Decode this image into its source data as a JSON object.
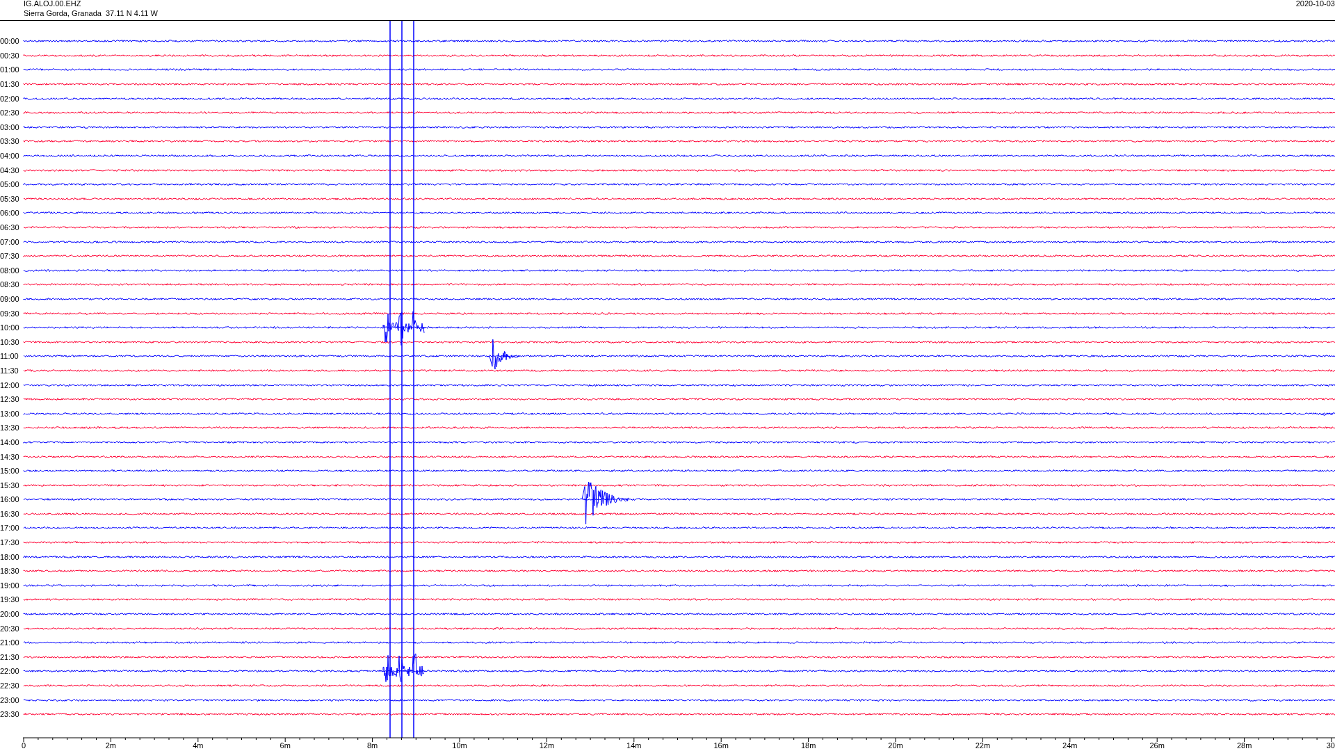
{
  "header": {
    "station": "IG.ALOJ.00.EHZ",
    "location": "Sierra Gorda, Granada  37.11 N 4.11 W",
    "date": "2020-10-03"
  },
  "rows": [
    {
      "time": "00:00",
      "color": "#0000ff"
    },
    {
      "time": "00:30",
      "color": "#ff0033"
    },
    {
      "time": "01:00",
      "color": "#0000ff"
    },
    {
      "time": "01:30",
      "color": "#ff0033"
    },
    {
      "time": "02:00",
      "color": "#0000ff"
    },
    {
      "time": "02:30",
      "color": "#ff0033"
    },
    {
      "time": "03:00",
      "color": "#0000ff"
    },
    {
      "time": "03:30",
      "color": "#ff0033"
    },
    {
      "time": "04:00",
      "color": "#0000ff"
    },
    {
      "time": "04:30",
      "color": "#ff0033"
    },
    {
      "time": "05:00",
      "color": "#0000ff"
    },
    {
      "time": "05:30",
      "color": "#ff0033"
    },
    {
      "time": "06:00",
      "color": "#0000ff"
    },
    {
      "time": "06:30",
      "color": "#ff0033"
    },
    {
      "time": "07:00",
      "color": "#0000ff"
    },
    {
      "time": "07:30",
      "color": "#ff0033"
    },
    {
      "time": "08:00",
      "color": "#0000ff"
    },
    {
      "time": "08:30",
      "color": "#ff0033"
    },
    {
      "time": "09:00",
      "color": "#0000ff"
    },
    {
      "time": "09:30",
      "color": "#ff0033"
    },
    {
      "time": "10:00",
      "color": "#0000ff"
    },
    {
      "time": "10:30",
      "color": "#ff0033"
    },
    {
      "time": "11:00",
      "color": "#0000ff"
    },
    {
      "time": "11:30",
      "color": "#ff0033"
    },
    {
      "time": "12:00",
      "color": "#0000ff"
    },
    {
      "time": "12:30",
      "color": "#ff0033"
    },
    {
      "time": "13:00",
      "color": "#0000ff"
    },
    {
      "time": "13:30",
      "color": "#ff0033"
    },
    {
      "time": "14:00",
      "color": "#0000ff"
    },
    {
      "time": "14:30",
      "color": "#ff0033"
    },
    {
      "time": "15:00",
      "color": "#0000ff"
    },
    {
      "time": "15:30",
      "color": "#ff0033"
    },
    {
      "time": "16:00",
      "color": "#0000ff"
    },
    {
      "time": "16:30",
      "color": "#ff0033"
    },
    {
      "time": "17:00",
      "color": "#0000ff"
    },
    {
      "time": "17:30",
      "color": "#ff0033"
    },
    {
      "time": "18:00",
      "color": "#0000ff"
    },
    {
      "time": "18:30",
      "color": "#ff0033"
    },
    {
      "time": "19:00",
      "color": "#0000ff"
    },
    {
      "time": "19:30",
      "color": "#ff0033"
    },
    {
      "time": "20:00",
      "color": "#0000ff"
    },
    {
      "time": "20:30",
      "color": "#ff0033"
    },
    {
      "time": "21:00",
      "color": "#0000ff"
    },
    {
      "time": "21:30",
      "color": "#ff0033"
    },
    {
      "time": "22:00",
      "color": "#0000ff"
    },
    {
      "time": "22:30",
      "color": "#ff0033"
    },
    {
      "time": "23:00",
      "color": "#0000ff"
    },
    {
      "time": "23:30",
      "color": "#ff0033"
    }
  ],
  "x_axis": {
    "tick_labels": [
      "0",
      "2m",
      "4m",
      "6m",
      "8m",
      "10m",
      "12m",
      "14m",
      "16m",
      "18m",
      "20m",
      "22m",
      "24m",
      "26m",
      "28m",
      "30"
    ]
  }
}
